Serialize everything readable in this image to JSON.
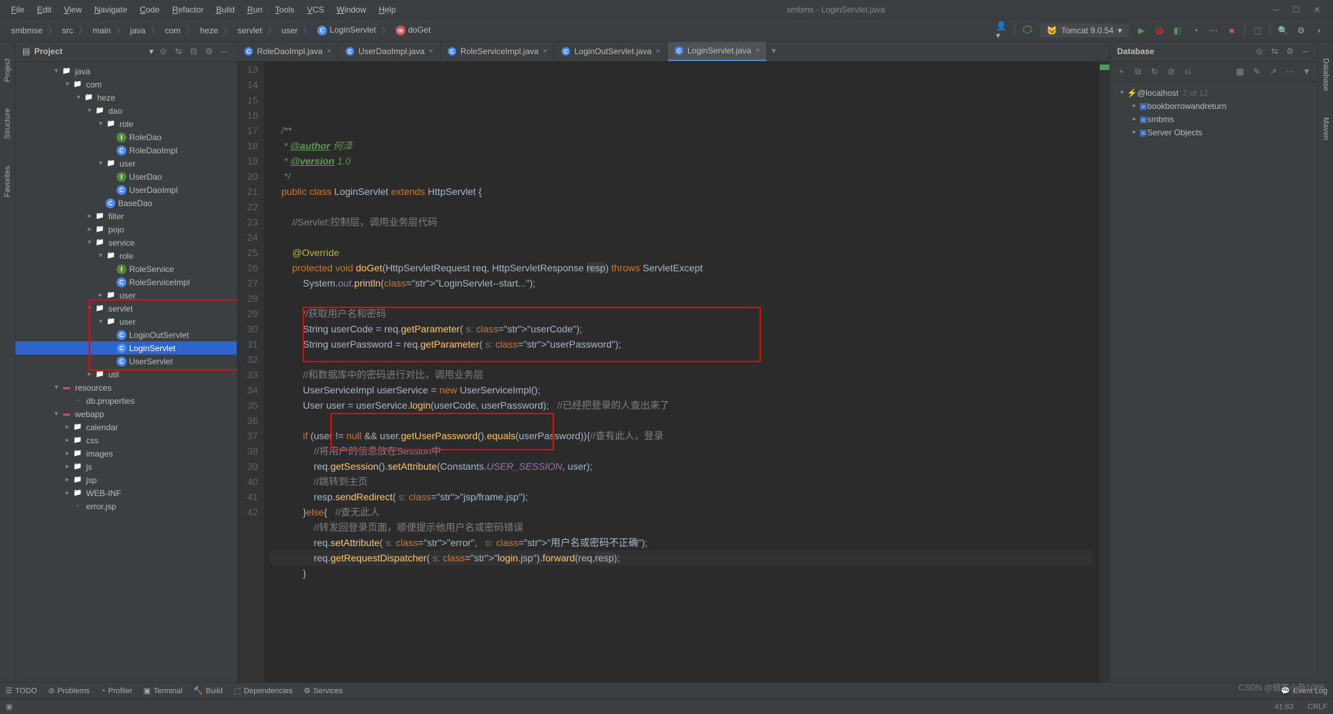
{
  "titlebar": {
    "menu": [
      "File",
      "Edit",
      "View",
      "Navigate",
      "Code",
      "Refactor",
      "Build",
      "Run",
      "Tools",
      "VCS",
      "Window",
      "Help"
    ],
    "title": "smbms - LoginServlet.java"
  },
  "breadcrumbs": [
    "smbmse",
    "src",
    "main",
    "java",
    "com",
    "heze",
    "servlet",
    "user",
    "LoginServlet",
    "doGet"
  ],
  "run_config": "Tomcat 9.0.54",
  "project_panel_title": "Project",
  "project_tree": [
    {
      "d": 3,
      "a": "v",
      "i": "folder",
      "l": "java"
    },
    {
      "d": 4,
      "a": "v",
      "i": "folder",
      "l": "com"
    },
    {
      "d": 5,
      "a": "v",
      "i": "folder",
      "l": "heze"
    },
    {
      "d": 6,
      "a": "v",
      "i": "folder",
      "l": "dao"
    },
    {
      "d": 7,
      "a": "v",
      "i": "folder",
      "l": "role"
    },
    {
      "d": 8,
      "a": "",
      "i": "interface",
      "l": "RoleDao"
    },
    {
      "d": 8,
      "a": "",
      "i": "class",
      "l": "RoleDaoImpl"
    },
    {
      "d": 7,
      "a": "v",
      "i": "folder",
      "l": "user"
    },
    {
      "d": 8,
      "a": "",
      "i": "interface",
      "l": "UserDao"
    },
    {
      "d": 8,
      "a": "",
      "i": "class",
      "l": "UserDaoImpl"
    },
    {
      "d": 7,
      "a": "",
      "i": "class",
      "l": "BaseDao"
    },
    {
      "d": 6,
      "a": ">",
      "i": "folder",
      "l": "filter"
    },
    {
      "d": 6,
      "a": ">",
      "i": "folder",
      "l": "pojo"
    },
    {
      "d": 6,
      "a": "v",
      "i": "folder",
      "l": "service"
    },
    {
      "d": 7,
      "a": "v",
      "i": "folder",
      "l": "role"
    },
    {
      "d": 8,
      "a": "",
      "i": "interface",
      "l": "RoleService"
    },
    {
      "d": 8,
      "a": "",
      "i": "class",
      "l": "RoleServiceImpl"
    },
    {
      "d": 7,
      "a": ">",
      "i": "folder",
      "l": "user"
    },
    {
      "d": 6,
      "a": "v",
      "i": "folder",
      "l": "servlet",
      "boxstart": true
    },
    {
      "d": 7,
      "a": "v",
      "i": "folder",
      "l": "user"
    },
    {
      "d": 8,
      "a": "",
      "i": "class",
      "l": "LoginOutServlet"
    },
    {
      "d": 8,
      "a": "",
      "i": "class",
      "l": "LoginServlet",
      "sel": true
    },
    {
      "d": 8,
      "a": "",
      "i": "class",
      "l": "UserServlet",
      "boxend": true
    },
    {
      "d": 6,
      "a": ">",
      "i": "folder",
      "l": "util"
    },
    {
      "d": 3,
      "a": "v",
      "i": "module",
      "l": "resources"
    },
    {
      "d": 4,
      "a": "",
      "i": "file",
      "l": "db.properties"
    },
    {
      "d": 3,
      "a": "v",
      "i": "module",
      "l": "webapp"
    },
    {
      "d": 4,
      "a": ">",
      "i": "folder",
      "l": "calendar"
    },
    {
      "d": 4,
      "a": ">",
      "i": "folder",
      "l": "css"
    },
    {
      "d": 4,
      "a": ">",
      "i": "folder",
      "l": "images"
    },
    {
      "d": 4,
      "a": ">",
      "i": "folder",
      "l": "js"
    },
    {
      "d": 4,
      "a": ">",
      "i": "folder",
      "l": "jsp"
    },
    {
      "d": 4,
      "a": ">",
      "i": "folder",
      "l": "WEB-INF"
    },
    {
      "d": 4,
      "a": "",
      "i": "file",
      "l": "error.jsp"
    }
  ],
  "tabs": [
    {
      "label": "RoleDaoImpl.java"
    },
    {
      "label": "UserDaoImpl.java"
    },
    {
      "label": "RoleServiceImpl.java"
    },
    {
      "label": "LoginOutServlet.java"
    },
    {
      "label": "LoginServlet.java",
      "active": true
    }
  ],
  "code_start_line": 13,
  "code_lines": [
    "    /**",
    "     * @author 何泽",
    "     * @version 1.0",
    "     */",
    "    public class LoginServlet extends HttpServlet {",
    "",
    "        //Servlet:控制层，调用业务层代码",
    "",
    "        @Override",
    "        protected void doGet(HttpServletRequest req, HttpServletResponse resp) throws ServletExcept",
    "            System.out.println(\"LoginServlet--start...\");",
    "",
    "            //获取用户名和密码",
    "            String userCode = req.getParameter( s: \"userCode\");",
    "            String userPassword = req.getParameter( s: \"userPassword\");",
    "",
    "            //和数据库中的密码进行对比，调用业务层",
    "            UserServiceImpl userService = new UserServiceImpl();",
    "            User user = userService.login(userCode, userPassword);   //已经把登录的人查出来了",
    "",
    "            if (user != null && user.getUserPassword().equals(userPassword)){//查有此人，登录",
    "                //将用户的信息放在Session中",
    "                req.getSession().setAttribute(Constants.USER_SESSION, user);",
    "                //跳转到主页",
    "                resp.sendRedirect( s: \"jsp/frame.jsp\");",
    "            }else{   //查无此人",
    "                //转发回登录页面，顺便提示他用户名或密码错误",
    "                req.setAttribute( s: \"error\",   o: \"用户名或密码不正确\");",
    "                req.getRequestDispatcher( s: \"login.jsp\").forward(req,resp);",
    "            }"
  ],
  "db_panel": {
    "title": "Database",
    "root": "@localhost",
    "root_meta": "2 of 12",
    "items": [
      "bookborrowandreturn",
      "smbms",
      "Server Objects"
    ]
  },
  "sidebar_left": [
    "Project",
    "Structure",
    "Favorites"
  ],
  "sidebar_right": [
    "Database",
    "Maven"
  ],
  "bottom_tools": [
    "TODO",
    "Problems",
    "Profiler",
    "Terminal",
    "Build",
    "Dependencies",
    "Services"
  ],
  "event_log": "Event Log",
  "status": {
    "pos": "41:63",
    "encoding": "CRLF",
    "lang": ""
  },
  "watermark": "CSDN @蜡笔小新1086"
}
